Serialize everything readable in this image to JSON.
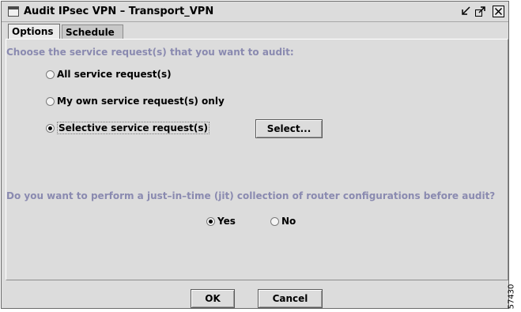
{
  "window": {
    "title": "Audit IPsec VPN – Transport_VPN"
  },
  "tabs": [
    {
      "label": "Options"
    },
    {
      "label": "Schedule"
    }
  ],
  "audit": {
    "prompt": "Choose the service request(s) that you want to audit:",
    "options": [
      {
        "label": "All service request(s)",
        "selected": false
      },
      {
        "label": "My own service request(s) only",
        "selected": false
      },
      {
        "label": "Selective service request(s)",
        "selected": true
      }
    ],
    "select_button": "Select..."
  },
  "jit": {
    "prompt": "Do you want to perform a just–in–time (jit) collection of router configurations before audit?",
    "options": [
      {
        "label": "Yes",
        "selected": true
      },
      {
        "label": "No",
        "selected": false
      }
    ]
  },
  "buttons": {
    "ok": "OK",
    "cancel": "Cancel"
  },
  "figure_code": "57430"
}
